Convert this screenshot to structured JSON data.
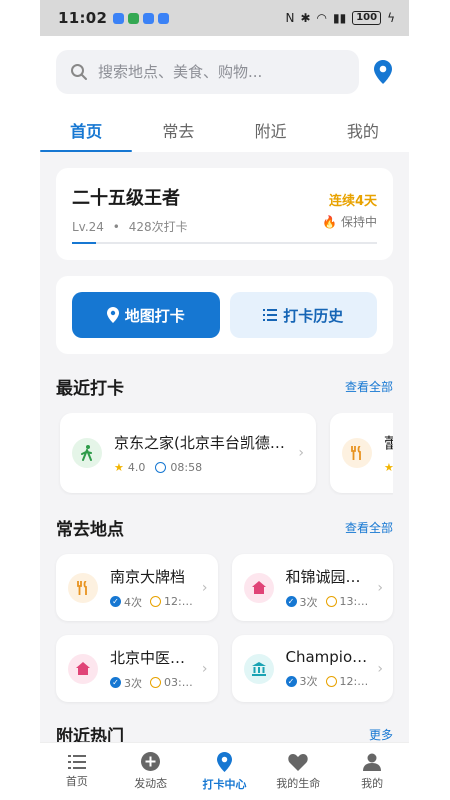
{
  "status_bar": {
    "time": "11:02",
    "battery": "100"
  },
  "search": {
    "placeholder": "搜索地点、美食、购物..."
  },
  "tabs": [
    {
      "label": "首页",
      "active": true
    },
    {
      "label": "常去",
      "active": false
    },
    {
      "label": "附近",
      "active": false
    },
    {
      "label": "我的",
      "active": false
    }
  ],
  "level": {
    "title": "二十五级王者",
    "level_label": "Lv.24",
    "separator": "•",
    "checkin_count": "428次打卡",
    "streak": "连续4天",
    "streak_status": "保持中",
    "progress": 0.08
  },
  "actions": {
    "map_checkin": "地图打卡",
    "history": "打卡历史"
  },
  "recent": {
    "title": "最近打卡",
    "more": "查看全部",
    "items": [
      {
        "name": "京东之家(北京丰台凯德…",
        "rating": "4.0",
        "time": "08:58",
        "icon": "walk-icon"
      },
      {
        "name": "蕾",
        "rating": "",
        "time": "",
        "icon": "fork-knife-icon"
      }
    ]
  },
  "frequent": {
    "title": "常去地点",
    "more": "查看全部",
    "items": [
      {
        "name": "南京大牌档",
        "count": "4次",
        "time": "12:…",
        "icon": "fork-knife-icon"
      },
      {
        "name": "和锦诚园…",
        "count": "3次",
        "time": "13:…",
        "icon": "home-icon"
      },
      {
        "name": "北京中医…",
        "count": "3次",
        "time": "03:…",
        "icon": "home-icon"
      },
      {
        "name": "Champio…",
        "count": "3次",
        "time": "12:…",
        "icon": "bank-icon"
      }
    ]
  },
  "nearby": {
    "title": "附近热门",
    "more": "更多"
  },
  "bottom_nav": [
    {
      "label": "首页",
      "icon": "list-icon",
      "active": false
    },
    {
      "label": "发动态",
      "icon": "plus-circle-icon",
      "active": false
    },
    {
      "label": "打卡中心",
      "icon": "location-pin-icon",
      "active": true
    },
    {
      "label": "我的生命",
      "icon": "heart-icon",
      "active": false
    },
    {
      "label": "我的",
      "icon": "person-icon",
      "active": false
    }
  ],
  "colors": {
    "accent": "#1677d2",
    "streak": "#e8a200"
  }
}
